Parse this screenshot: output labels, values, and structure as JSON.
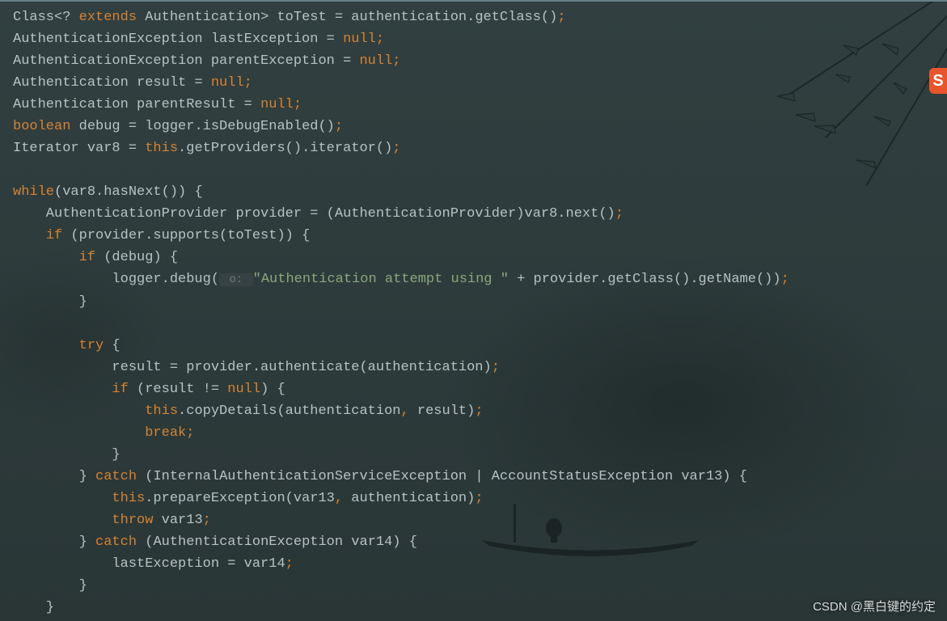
{
  "watermark": "CSDN @黑白键的约定",
  "ribbon_glyph": "S",
  "code": {
    "l1": {
      "a": "Class<? ",
      "b": "extends",
      "c": " Authentication> toTest = authentication.getClass()",
      "d": ";"
    },
    "l2": {
      "a": "AuthenticationException lastException = ",
      "b": "null",
      "c": ";"
    },
    "l3": {
      "a": "AuthenticationException parentException = ",
      "b": "null",
      "c": ";"
    },
    "l4": {
      "a": "Authentication result = ",
      "b": "null",
      "c": ";"
    },
    "l5": {
      "a": "Authentication parentResult = ",
      "b": "null",
      "c": ";"
    },
    "l6": {
      "a": "boolean",
      "b": " debug = logger.isDebugEnabled()",
      "c": ";"
    },
    "l7": {
      "a": "Iterator var8 = ",
      "b": "this",
      "c": ".getProviders().iterator()",
      "d": ";"
    },
    "l8": "",
    "l9": {
      "a": "while",
      "b": "(var8.hasNext()) {"
    },
    "l10": {
      "a": "    AuthenticationProvider provider = (AuthenticationProvider)var8.next()",
      "b": ";"
    },
    "l11": {
      "a": "    ",
      "b": "if",
      "c": " (provider.supports(toTest)) {"
    },
    "l12": {
      "a": "        ",
      "b": "if",
      "c": " (debug) {"
    },
    "l13": {
      "a": "            logger.debug(",
      "p": " o: ",
      "s": "\"Authentication attempt using \"",
      "b": " + provider.getClass().getName())",
      "c": ";"
    },
    "l14": "        }",
    "l15": "",
    "l16": {
      "a": "        ",
      "b": "try",
      "c": " {"
    },
    "l17": {
      "a": "            result = provider.authenticate(authentication)",
      "b": ";"
    },
    "l18": {
      "a": "            ",
      "b": "if",
      "c": " (result != ",
      "d": "null",
      "e": ") {"
    },
    "l19": {
      "a": "                ",
      "b": "this",
      "c": ".copyDetails(authentication",
      "d": ", ",
      "e": "result)",
      "f": ";"
    },
    "l20": {
      "a": "                ",
      "b": "break",
      "c": ";"
    },
    "l21": "            }",
    "l22": {
      "a": "        } ",
      "b": "catch",
      "c": " (InternalAuthenticationServiceException | AccountStatusException var13) {"
    },
    "l23": {
      "a": "            ",
      "b": "this",
      "c": ".prepareException(var13",
      "d": ", ",
      "e": "authentication)",
      "f": ";"
    },
    "l24": {
      "a": "            ",
      "b": "throw",
      "c": " var13",
      "d": ";"
    },
    "l25": {
      "a": "        } ",
      "b": "catch",
      "c": " (AuthenticationException var14) {"
    },
    "l26": {
      "a": "            lastException = var14",
      "b": ";"
    },
    "l27": "        }",
    "l28": "    }"
  }
}
